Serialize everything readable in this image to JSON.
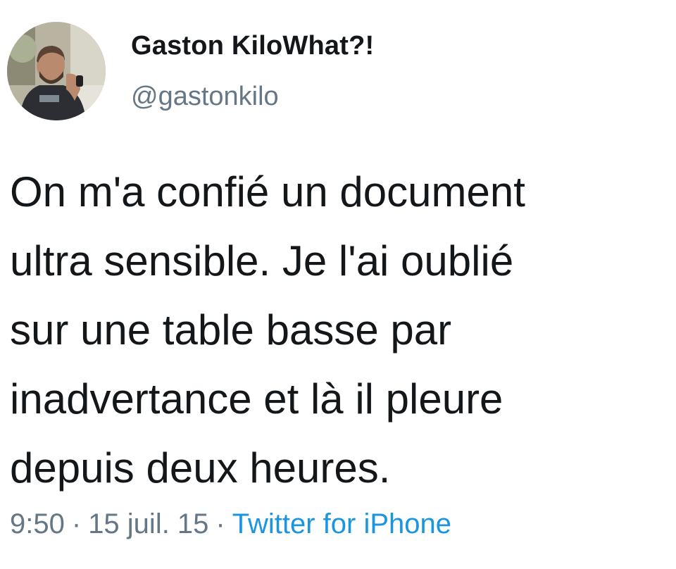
{
  "author": {
    "display_name": "Gaston KiloWhat?!",
    "handle": "@gastonkilo"
  },
  "tweet": {
    "text_lines": [
      "On m'a confié un document",
      "ultra sensible. Je l'ai oublié",
      "sur une table basse par",
      "inadvertance et là il pleure",
      "depuis deux heures."
    ]
  },
  "meta": {
    "time": "9:50",
    "separator": "·",
    "date": "15 juil. 15",
    "source": "Twitter for iPhone"
  },
  "colors": {
    "text": "#14171a",
    "secondary": "#657786",
    "link": "#1b95e0",
    "background": "#ffffff"
  }
}
